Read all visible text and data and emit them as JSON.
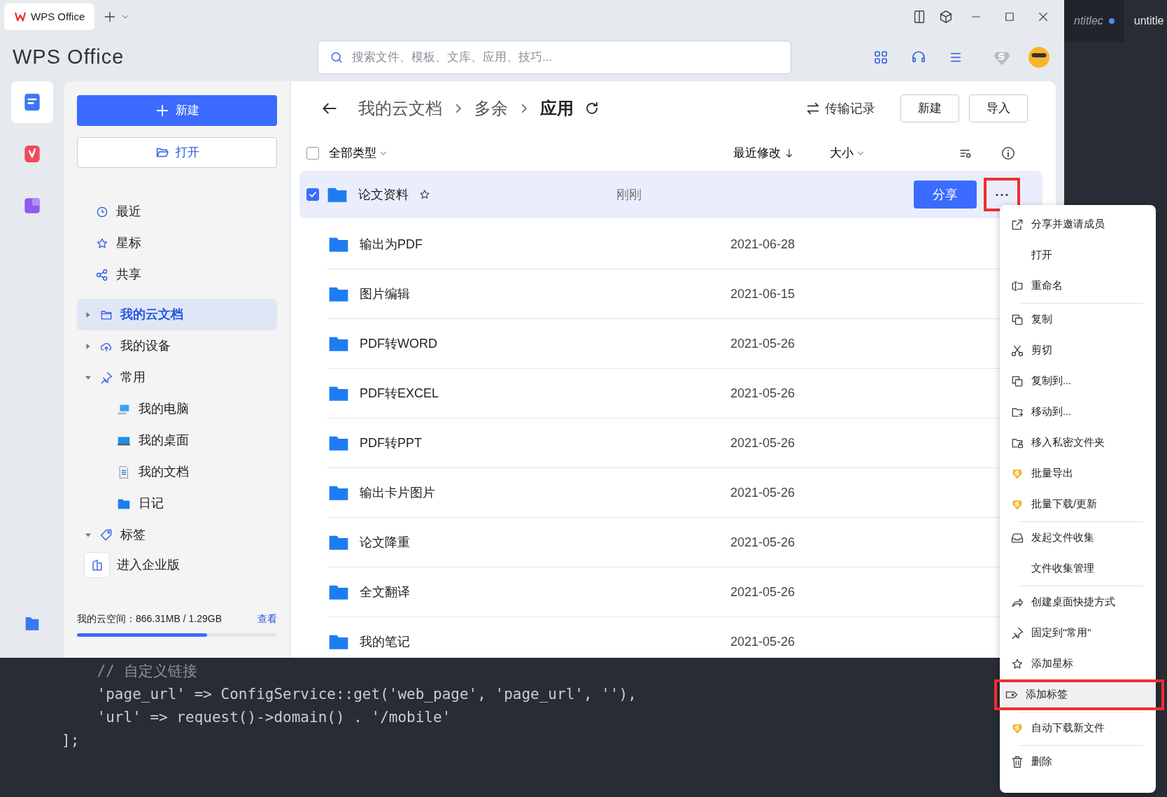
{
  "editor": {
    "tabs": [
      {
        "label": "ntitlec",
        "modified": true
      },
      {
        "label": "untitle",
        "modified": false
      }
    ],
    "code_lines": [
      {
        "kind": "comment",
        "text": "    // 自定义链接"
      },
      {
        "kind": "code",
        "text": "    'page_url' => ConfigService::get('web_page', 'page_url', ''),"
      },
      {
        "kind": "code",
        "text": "    'url' => request()->domain() . '/mobile'"
      },
      {
        "kind": "code",
        "text": "];"
      }
    ]
  },
  "window": {
    "tab_title": "WPS Office",
    "logo": "WPS Office",
    "search": {
      "placeholder": "搜索文件、模板、文库、应用、技巧..."
    }
  },
  "app_rail": [
    {
      "selected": true
    },
    {
      "selected": false
    },
    {
      "selected": false
    },
    {
      "selected": false
    }
  ],
  "sidebar": {
    "new_button": "新建",
    "open_button": "打开",
    "quick_items": [
      {
        "label": "最近"
      },
      {
        "label": "星标"
      },
      {
        "label": "共享"
      }
    ],
    "tree": [
      {
        "label": "我的云文档",
        "selected": true,
        "expanded": false
      },
      {
        "label": "我的设备",
        "selected": false,
        "expanded": false
      },
      {
        "label": "常用",
        "selected": false,
        "expanded": true,
        "children": [
          {
            "label": "我的电脑",
            "selected": false
          },
          {
            "label": "我的桌面",
            "selected": false
          },
          {
            "label": "我的文档",
            "selected": false
          },
          {
            "label": "日记",
            "selected": false
          }
        ]
      },
      {
        "label": "标签",
        "selected": false,
        "expanded": true
      }
    ],
    "enterprise": "进入企业版",
    "storage": {
      "label": "我的云空间：866.31MB / 1.29GB",
      "link": "查看",
      "level": 0.65
    }
  },
  "main": {
    "breadcrumb": [
      {
        "label": "我的云文档",
        "current": false
      },
      {
        "label": "多余",
        "current": false
      },
      {
        "label": "应用",
        "current": true
      }
    ],
    "transfer": "传输记录",
    "buttons": [
      "新建",
      "导入"
    ],
    "header": {
      "all_checked": false,
      "type_filter": "全部类型",
      "sort": "最近修改",
      "size": "大小"
    },
    "share_button": "分享",
    "more_annotated": true,
    "rows": [
      {
        "name": "论文资料",
        "modified": "刚刚",
        "checked": true,
        "selected": true
      },
      {
        "name": "输出为PDF",
        "modified": "2021-06-28",
        "checked": false,
        "selected": false
      },
      {
        "name": "图片编辑",
        "modified": "2021-06-15",
        "checked": false,
        "selected": false
      },
      {
        "name": "PDF转WORD",
        "modified": "2021-05-26",
        "checked": false,
        "selected": false
      },
      {
        "name": "PDF转EXCEL",
        "modified": "2021-05-26",
        "checked": false,
        "selected": false
      },
      {
        "name": "PDF转PPT",
        "modified": "2021-05-26",
        "checked": false,
        "selected": false
      },
      {
        "name": "输出卡片图片",
        "modified": "2021-05-26",
        "checked": false,
        "selected": false
      },
      {
        "name": "论文降重",
        "modified": "2021-05-26",
        "checked": false,
        "selected": false
      },
      {
        "name": "全文翻译",
        "modified": "2021-05-26",
        "checked": false,
        "selected": false
      },
      {
        "name": "我的笔记",
        "modified": "2021-05-26",
        "checked": false,
        "selected": false
      }
    ]
  },
  "menu": {
    "groups": [
      [
        {
          "label": "分享并邀请成员",
          "kind": "icon",
          "hovered": false,
          "annotated": false
        },
        {
          "label": "打开",
          "kind": "blank",
          "hovered": false,
          "annotated": false
        },
        {
          "label": "重命名",
          "kind": "icon",
          "hovered": false,
          "annotated": false
        }
      ],
      [
        {
          "label": "复制",
          "kind": "icon",
          "hovered": false,
          "annotated": false
        },
        {
          "label": "剪切",
          "kind": "icon",
          "hovered": false,
          "annotated": false
        },
        {
          "label": "复制到...",
          "kind": "icon",
          "hovered": false,
          "annotated": false
        },
        {
          "label": "移动到...",
          "kind": "icon",
          "hovered": false,
          "annotated": false
        },
        {
          "label": "移入私密文件夹",
          "kind": "icon",
          "hovered": false,
          "annotated": false
        },
        {
          "label": "批量导出",
          "kind": "premium",
          "hovered": false,
          "annotated": false
        },
        {
          "label": "批量下载/更新",
          "kind": "premium",
          "hovered": false,
          "annotated": false
        }
      ],
      [
        {
          "label": "发起文件收集",
          "kind": "icon",
          "hovered": false,
          "annotated": false
        },
        {
          "label": "文件收集管理",
          "kind": "blank",
          "hovered": false,
          "annotated": false
        }
      ],
      [
        {
          "label": "创建桌面快捷方式",
          "kind": "icon",
          "hovered": false,
          "annotated": false
        },
        {
          "label": "固定到\"常用\"",
          "kind": "icon",
          "hovered": false,
          "annotated": false
        },
        {
          "label": "添加星标",
          "kind": "icon",
          "hovered": false,
          "annotated": false
        },
        {
          "label": "添加标签",
          "kind": "icon",
          "hovered": true,
          "annotated": true
        }
      ],
      [
        {
          "label": "自动下载新文件",
          "kind": "premium",
          "hovered": false,
          "annotated": false
        }
      ],
      [
        {
          "label": "删除",
          "kind": "icon",
          "hovered": false,
          "annotated": false
        }
      ]
    ]
  }
}
